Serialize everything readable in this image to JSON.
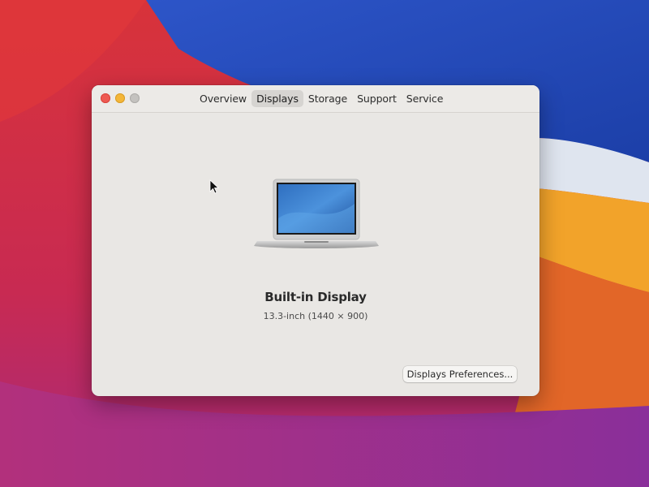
{
  "window": {
    "tabs": [
      {
        "label": "Overview",
        "active": false
      },
      {
        "label": "Displays",
        "active": true
      },
      {
        "label": "Storage",
        "active": false
      },
      {
        "label": "Support",
        "active": false
      },
      {
        "label": "Service",
        "active": false
      }
    ]
  },
  "display": {
    "name": "Built-in Display",
    "spec": "13.3-inch (1440 × 900)"
  },
  "buttons": {
    "preferences_label": "Displays Preferences..."
  },
  "icons": {
    "laptop": "macbook-air-icon",
    "cursor": "mouse-pointer-icon"
  },
  "colors": {
    "close": "#ee5a52",
    "minimize": "#f4b638",
    "zoom_inactive": "#c4c2bf",
    "window_bg": "#e9e7e4"
  }
}
